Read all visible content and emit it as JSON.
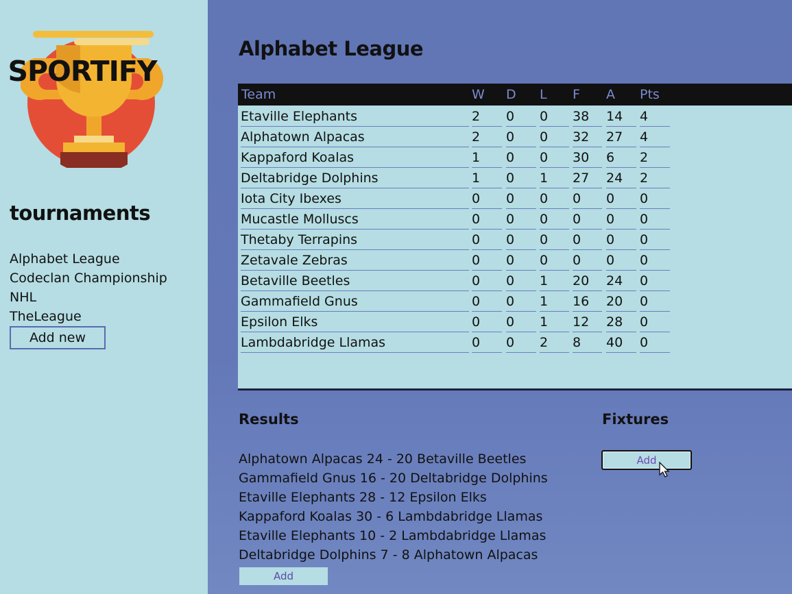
{
  "sidebar": {
    "logo_text": "SPORTIFY",
    "heading": "tournaments",
    "tournaments": [
      "Alphabet League",
      "Codeclan Championship",
      "NHL",
      "TheLeague"
    ],
    "add_new_label": "Add new"
  },
  "main": {
    "title": "Alphabet League",
    "table": {
      "headers": [
        "Team",
        "W",
        "D",
        "L",
        "F",
        "A",
        "Pts"
      ],
      "rows": [
        [
          "Etaville Elephants",
          "2",
          "0",
          "0",
          "38",
          "14",
          "4"
        ],
        [
          "Alphatown Alpacas",
          "2",
          "0",
          "0",
          "32",
          "27",
          "4"
        ],
        [
          "Kappaford Koalas",
          "1",
          "0",
          "0",
          "30",
          "6",
          "2"
        ],
        [
          "Deltabridge Dolphins",
          "1",
          "0",
          "1",
          "27",
          "24",
          "2"
        ],
        [
          "Iota City Ibexes",
          "0",
          "0",
          "0",
          "0",
          "0",
          "0"
        ],
        [
          "Mucastle Molluscs",
          "0",
          "0",
          "0",
          "0",
          "0",
          "0"
        ],
        [
          "Thetaby Terrapins",
          "0",
          "0",
          "0",
          "0",
          "0",
          "0"
        ],
        [
          "Zetavale Zebras",
          "0",
          "0",
          "0",
          "0",
          "0",
          "0"
        ],
        [
          "Betaville Beetles",
          "0",
          "0",
          "1",
          "20",
          "24",
          "0"
        ],
        [
          "Gammafield Gnus",
          "0",
          "0",
          "1",
          "16",
          "20",
          "0"
        ],
        [
          "Epsilon Elks",
          "0",
          "0",
          "1",
          "12",
          "28",
          "0"
        ],
        [
          "Lambdabridge Llamas",
          "0",
          "0",
          "2",
          "8",
          "40",
          "0"
        ]
      ]
    },
    "results": {
      "heading": "Results",
      "items": [
        "Alphatown Alpacas 24 - 20 Betaville Beetles",
        "Gammafield Gnus 16 - 20 Deltabridge Dolphins",
        "Etaville Elephants 28 - 12 Epsilon Elks",
        "Kappaford Koalas 30 - 6 Lambdabridge Llamas",
        "Etaville Elephants 10 - 2 Lambdabridge Llamas",
        "Deltabridge Dolphins 7 - 8 Alphatown Alpacas"
      ],
      "add_label": "Add"
    },
    "fixtures": {
      "heading": "Fixtures",
      "add_label": "Add"
    }
  },
  "colors": {
    "sidebar_bg": "#b5dde3",
    "main_bg": "#6176b5",
    "table_header_bg": "#111111",
    "table_header_text": "#7b8bd0",
    "accent": "#5a6ab1"
  }
}
